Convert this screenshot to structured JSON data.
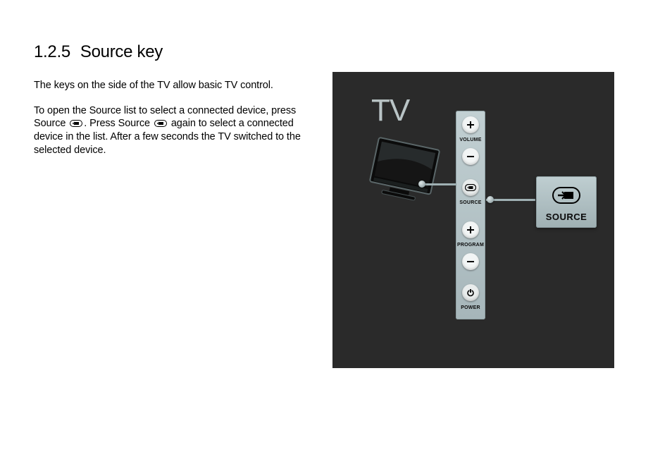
{
  "heading": {
    "number": "1.2.5",
    "title": "Source key"
  },
  "paragraphs": {
    "p1": "The keys on the side of the TV allow basic TV control.",
    "p2a": "To open the Source list to select a connected device, press Source ",
    "p2b": ". Press Source ",
    "p2c": " again to select a connected device in the list. After a few seconds the TV switched to the selected device."
  },
  "figure": {
    "tv_label": "TV",
    "strip": {
      "volume": "VOLUME",
      "source": "SOURCE",
      "program": "PROGRAM",
      "power": "POWER"
    },
    "callout": {
      "label": "SOURCE"
    }
  }
}
